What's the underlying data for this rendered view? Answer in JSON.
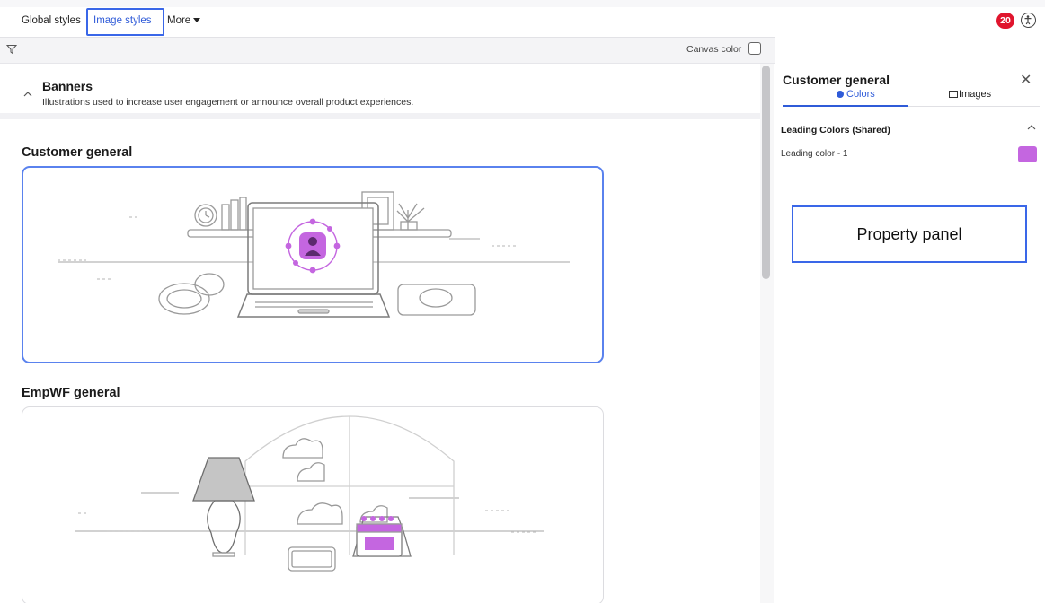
{
  "topbar": {
    "tabs": [
      {
        "label": "Global styles"
      },
      {
        "label": "Image styles"
      },
      {
        "label": "More"
      }
    ],
    "notification_count": "20"
  },
  "toolbar": {
    "canvas_color_label": "Canvas color"
  },
  "banners": {
    "title": "Banners",
    "description": "Illustrations used to increase user engagement or announce overall product experiences."
  },
  "sections": [
    {
      "title": "Customer general"
    },
    {
      "title": "EmpWF general"
    }
  ],
  "panel": {
    "title": "Customer general",
    "tabs": [
      {
        "label": "Colors"
      },
      {
        "label": "Images"
      }
    ],
    "leading_colors_heading": "Leading Colors (Shared)",
    "leading_color_label": "Leading color - 1",
    "leading_color_value": "#c466e0",
    "annotation": "Property panel"
  },
  "colors": {
    "accent": "#2f5bd8",
    "badge": "#e0152d",
    "selected_card_border": "#5a82ee"
  }
}
